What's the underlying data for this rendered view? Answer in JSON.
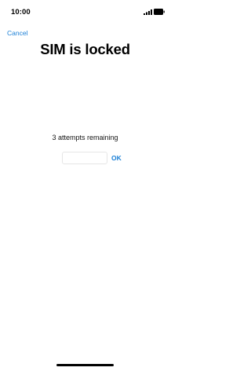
{
  "status_bar": {
    "time": "10:00",
    "signal_icon": "cellular-signal-icon",
    "battery_icon": "battery-icon"
  },
  "nav": {
    "cancel_label": "Cancel"
  },
  "title": "SIM is locked",
  "attempts": {
    "message": "3 attempts remaining"
  },
  "pin_field": {
    "value": "",
    "placeholder": ""
  },
  "ok_label": "OK",
  "colors": {
    "accent": "#1a7fd6",
    "background": "#ffffff",
    "text": "#000000"
  }
}
